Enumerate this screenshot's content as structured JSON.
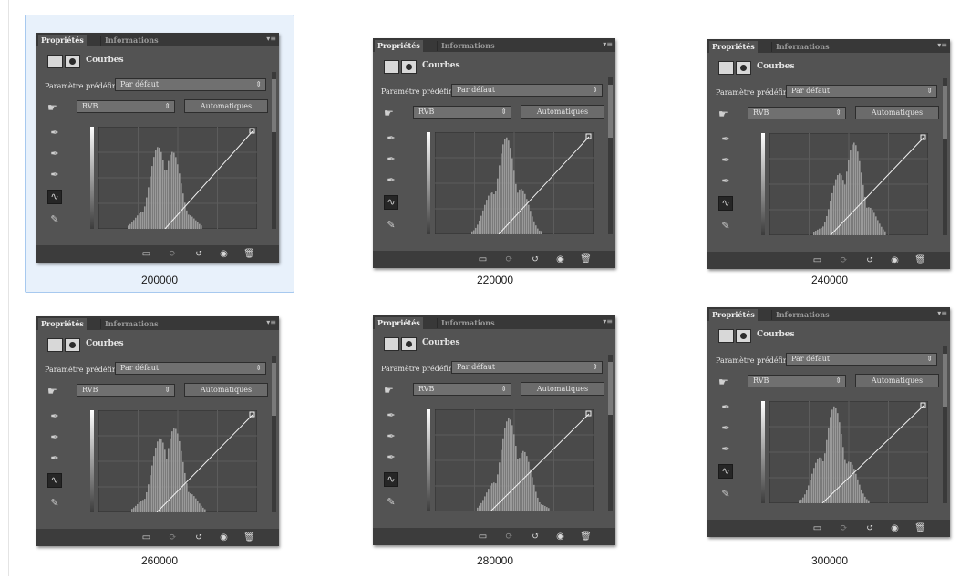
{
  "panel": {
    "tabs": [
      "Propriétés",
      "Informations"
    ],
    "title": "Courbes",
    "preset_label": "Paramètre prédéfini :",
    "preset_value": "Par défaut",
    "channel_value": "RVB",
    "auto_button": "Automatiques",
    "menu_icon": "panel-menu-icon",
    "tools": [
      "eyedropper-black-icon",
      "eyedropper-gray-icon",
      "eyedropper-white-icon",
      "curve-tool-icon",
      "pencil-icon"
    ],
    "bottom_icons": [
      "clip-to-layer-icon",
      "view-previous-icon",
      "reset-icon",
      "visibility-icon",
      "trash-icon"
    ]
  },
  "thumbnails": [
    {
      "caption": "200000",
      "selected": true
    },
    {
      "caption": "220000",
      "selected": false
    },
    {
      "caption": "240000",
      "selected": false
    },
    {
      "caption": "260000",
      "selected": false
    },
    {
      "caption": "280000",
      "selected": false
    },
    {
      "caption": "300000",
      "selected": false
    }
  ]
}
